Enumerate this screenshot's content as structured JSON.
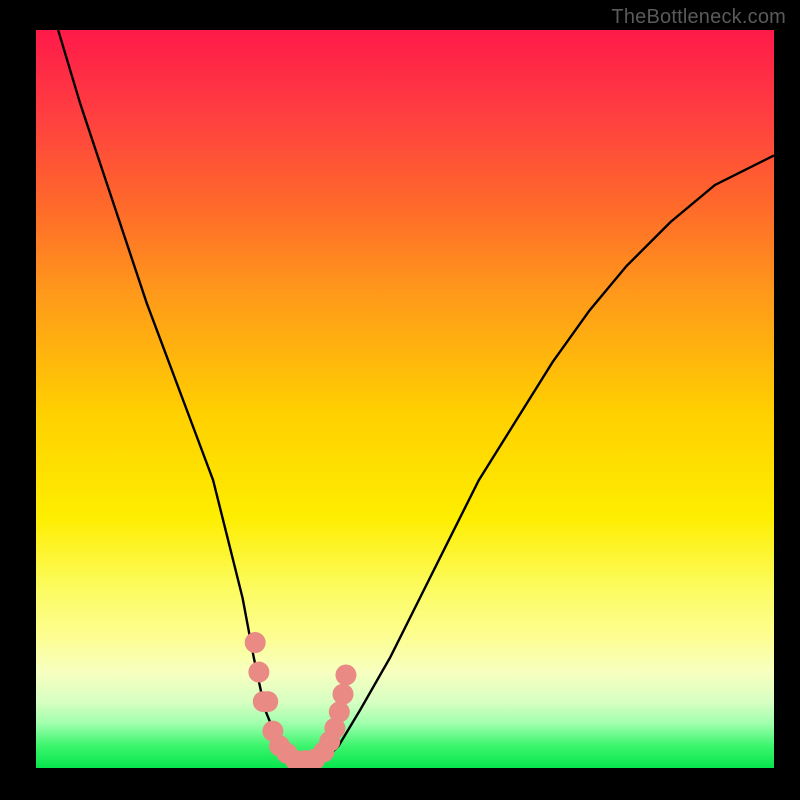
{
  "watermark": "TheBottleneck.com",
  "chart_data": {
    "type": "line",
    "title": "",
    "xlabel": "",
    "ylabel": "",
    "xlim": [
      0,
      100
    ],
    "ylim": [
      0,
      100
    ],
    "grid": false,
    "legend": false,
    "series": [
      {
        "name": "curve",
        "color": "#000000",
        "x": [
          3,
          6,
          9,
          12,
          15,
          18,
          21,
          24,
          26,
          28,
          29.5,
          31,
          33,
          35,
          37,
          39,
          41,
          44,
          48,
          52,
          56,
          60,
          65,
          70,
          75,
          80,
          86,
          92,
          100
        ],
        "y": [
          100,
          90,
          81,
          72,
          63,
          55,
          47,
          39,
          31,
          23,
          15,
          8,
          3,
          1,
          0.5,
          1,
          3,
          8,
          15,
          23,
          31,
          39,
          47,
          55,
          62,
          68,
          74,
          79,
          83
        ]
      },
      {
        "name": "bottom-markers",
        "style": "markers",
        "color": "#e98a84",
        "points_xy": [
          [
            29.7,
            17
          ],
          [
            30.2,
            13
          ],
          [
            30.8,
            9
          ],
          [
            31.4,
            9
          ],
          [
            32.1,
            5
          ],
          [
            33.0,
            3
          ],
          [
            34.0,
            2
          ],
          [
            35.2,
            1
          ],
          [
            36.5,
            1
          ],
          [
            37.8,
            1.2
          ],
          [
            39.0,
            2.2
          ],
          [
            39.8,
            3.6
          ],
          [
            40.5,
            5.4
          ],
          [
            41.1,
            7.6
          ],
          [
            41.6,
            10.0
          ],
          [
            42.0,
            12.6
          ]
        ]
      }
    ]
  }
}
